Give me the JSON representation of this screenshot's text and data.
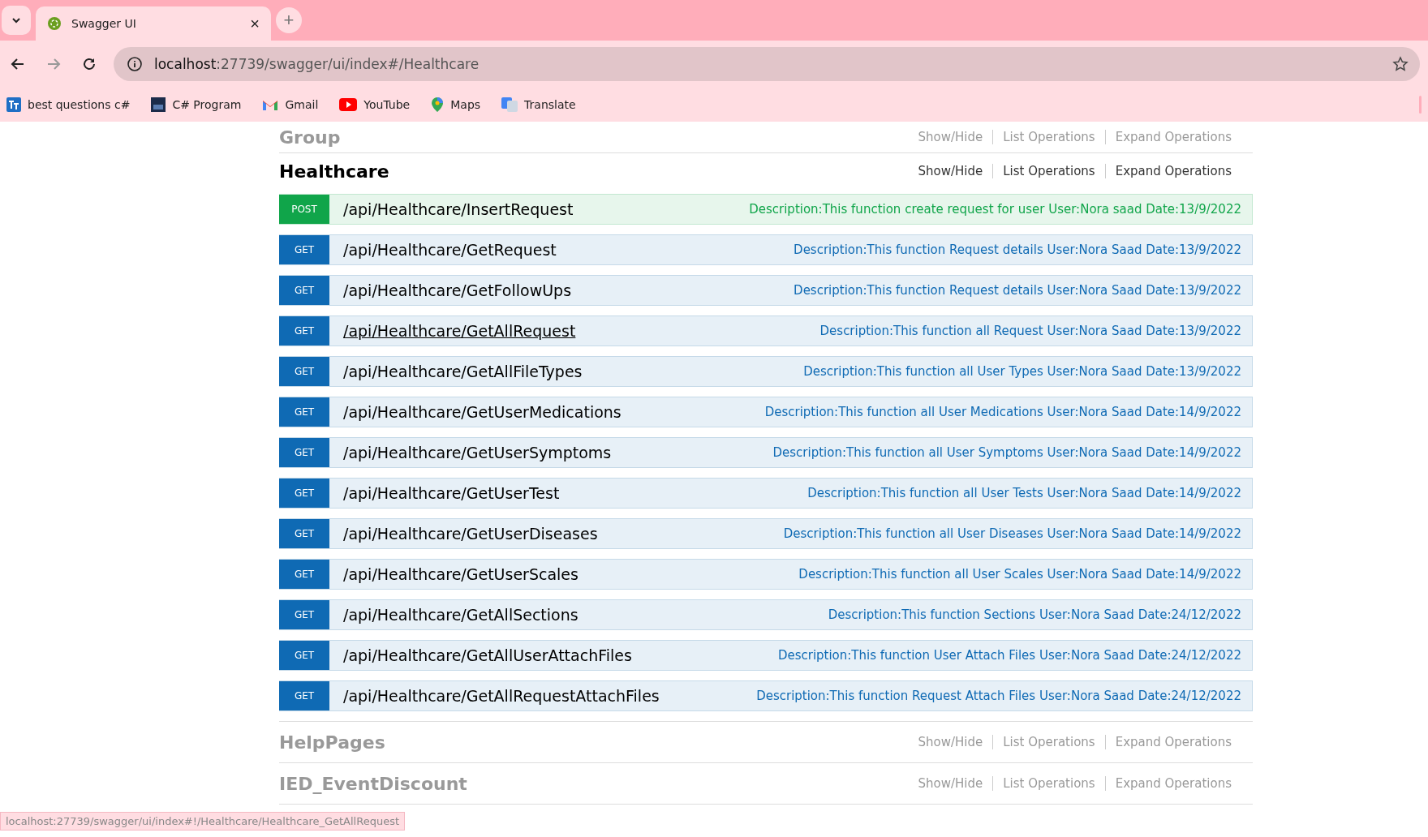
{
  "browser": {
    "tab_title": "Swagger UI",
    "new_tab": "+",
    "close": "×",
    "address_host": "localhost",
    "address_rest": ":27739/swagger/ui/index#/Healthcare",
    "bookmarks": [
      {
        "label": "best questions c#",
        "kind": "tt"
      },
      {
        "label": "C# Program",
        "kind": "sf"
      },
      {
        "label": "Gmail",
        "kind": "gmail"
      },
      {
        "label": "YouTube",
        "kind": "youtube"
      },
      {
        "label": "Maps",
        "kind": "maps"
      },
      {
        "label": "Translate",
        "kind": "translate"
      }
    ]
  },
  "sections_before": [
    {
      "name": "Group",
      "expanded": false,
      "links": [
        "Show/Hide",
        "List Operations",
        "Expand Operations"
      ]
    }
  ],
  "section": {
    "name": "Healthcare",
    "expanded": true,
    "links": [
      "Show/Hide",
      "List Operations",
      "Expand Operations"
    ],
    "operations": [
      {
        "method": "POST",
        "path": "/api/Healthcare/InsertRequest",
        "hovered": false,
        "description": "Description:This function create request for user User:Nora saad Date:13/9/2022"
      },
      {
        "method": "GET",
        "path": "/api/Healthcare/GetRequest",
        "hovered": false,
        "description": "Description:This function Request details User:Nora Saad Date:13/9/2022"
      },
      {
        "method": "GET",
        "path": "/api/Healthcare/GetFollowUps",
        "hovered": false,
        "description": "Description:This function Request details User:Nora Saad Date:13/9/2022"
      },
      {
        "method": "GET",
        "path": "/api/Healthcare/GetAllRequest",
        "hovered": true,
        "description": "Description:This function all Request User:Nora Saad Date:13/9/2022"
      },
      {
        "method": "GET",
        "path": "/api/Healthcare/GetAllFileTypes",
        "hovered": false,
        "description": "Description:This function all User Types User:Nora Saad Date:13/9/2022"
      },
      {
        "method": "GET",
        "path": "/api/Healthcare/GetUserMedications",
        "hovered": false,
        "description": "Description:This function all User Medications User:Nora Saad Date:14/9/2022"
      },
      {
        "method": "GET",
        "path": "/api/Healthcare/GetUserSymptoms",
        "hovered": false,
        "description": "Description:This function all User Symptoms User:Nora Saad Date:14/9/2022"
      },
      {
        "method": "GET",
        "path": "/api/Healthcare/GetUserTest",
        "hovered": false,
        "description": "Description:This function all User Tests User:Nora Saad Date:14/9/2022"
      },
      {
        "method": "GET",
        "path": "/api/Healthcare/GetUserDiseases",
        "hovered": false,
        "description": "Description:This function all User Diseases User:Nora Saad Date:14/9/2022"
      },
      {
        "method": "GET",
        "path": "/api/Healthcare/GetUserScales",
        "hovered": false,
        "description": "Description:This function all User Scales User:Nora Saad Date:14/9/2022"
      },
      {
        "method": "GET",
        "path": "/api/Healthcare/GetAllSections",
        "hovered": false,
        "description": "Description:This function Sections User:Nora Saad Date:24/12/2022"
      },
      {
        "method": "GET",
        "path": "/api/Healthcare/GetAllUserAttachFiles",
        "hovered": false,
        "description": "Description:This function User Attach Files User:Nora Saad Date:24/12/2022"
      },
      {
        "method": "GET",
        "path": "/api/Healthcare/GetAllRequestAttachFiles",
        "hovered": false,
        "description": "Description:This function Request Attach Files User:Nora Saad Date:24/12/2022"
      }
    ]
  },
  "sections_after": [
    {
      "name": "HelpPages",
      "expanded": false,
      "links": [
        "Show/Hide",
        "List Operations",
        "Expand Operations"
      ]
    },
    {
      "name": "IED_EventDiscount",
      "expanded": false,
      "links": [
        "Show/Hide",
        "List Operations",
        "Expand Operations"
      ]
    }
  ],
  "status_url": "localhost:27739/swagger/ui/index#!/Healthcare/Healthcare_GetAllRequest"
}
